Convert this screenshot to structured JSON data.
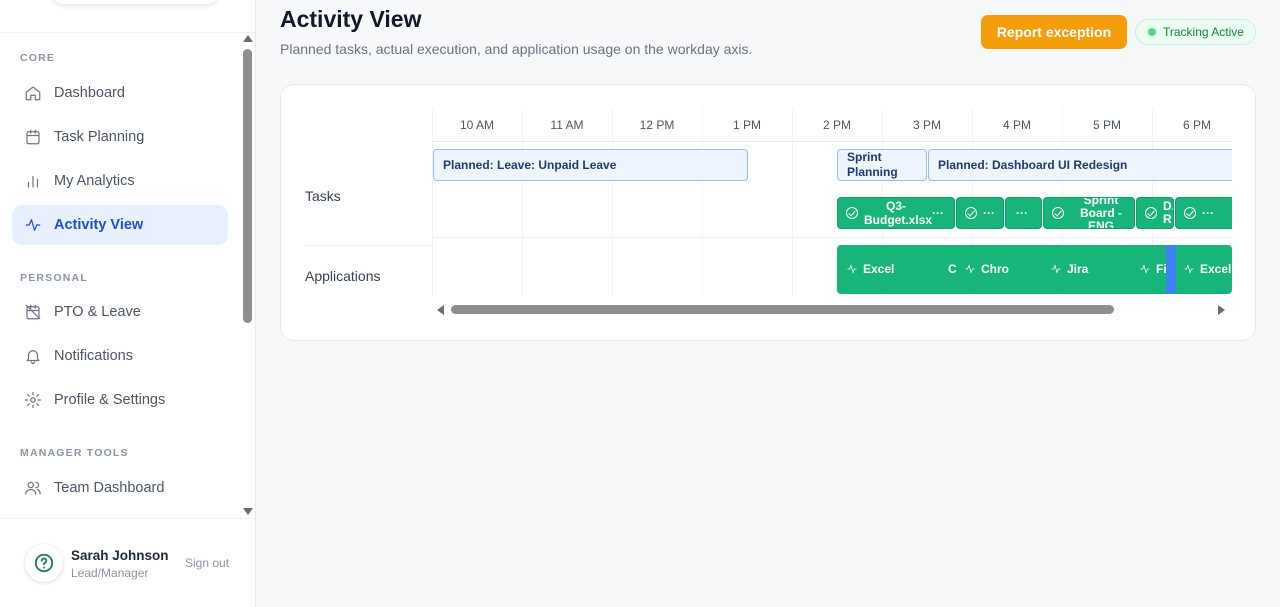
{
  "sidebar": {
    "sections": [
      {
        "label": "CORE"
      },
      {
        "label": "PERSONAL"
      },
      {
        "label": "MANAGER TOOLS"
      }
    ],
    "items": [
      {
        "label": "Dashboard",
        "icon": "home-icon"
      },
      {
        "label": "Task Planning",
        "icon": "calendar-icon"
      },
      {
        "label": "My Analytics",
        "icon": "bar-chart-icon"
      },
      {
        "label": "Activity View",
        "icon": "activity-icon",
        "active": true
      },
      {
        "label": "PTO & Leave",
        "icon": "calendar-off-icon"
      },
      {
        "label": "Notifications",
        "icon": "bell-icon"
      },
      {
        "label": "Profile & Settings",
        "icon": "gear-icon"
      },
      {
        "label": "Team Dashboard",
        "icon": "users-icon"
      }
    ],
    "user": {
      "name": "Sarah Johnson",
      "role": "Lead/Manager",
      "sign_out": "Sign out",
      "avatar_icon": "help-circle-icon"
    }
  },
  "header": {
    "title": "Activity View",
    "subtitle": "Planned tasks, actual execution, and application usage on the workday axis.",
    "report_button": "Report exception",
    "tracking_status": "Tracking Active"
  },
  "timeline": {
    "rows": [
      "Tasks",
      "Applications"
    ],
    "hours": [
      "10 AM",
      "11 AM",
      "12 PM",
      "1 PM",
      "2 PM",
      "3 PM",
      "4 PM",
      "5 PM",
      "6 PM"
    ],
    "planned": [
      {
        "label": "Planned: Leave: Unpaid Leave"
      },
      {
        "label": "Sprint Planning"
      },
      {
        "label": "Planned: Dashboard UI Redesign"
      }
    ],
    "actual": [
      {
        "label": "Q3-Budget.xlsx"
      },
      {
        "label": "···"
      },
      {
        "label": "···"
      },
      {
        "label": "···"
      },
      {
        "label": "Sprint Board - ENG"
      },
      {
        "label": "D... R"
      },
      {
        "label": "···"
      }
    ],
    "applications": [
      {
        "label": "Excel"
      },
      {
        "label": "C"
      },
      {
        "label": "Chro"
      },
      {
        "label": "Jira"
      },
      {
        "label": "Fi"
      },
      {
        "label": "Excel"
      }
    ],
    "colors": {
      "planned_fill": "#eef5ff",
      "actual_fill": "#17b57a",
      "highlight": "#3b82f6",
      "accent": "#f59e0b"
    }
  }
}
